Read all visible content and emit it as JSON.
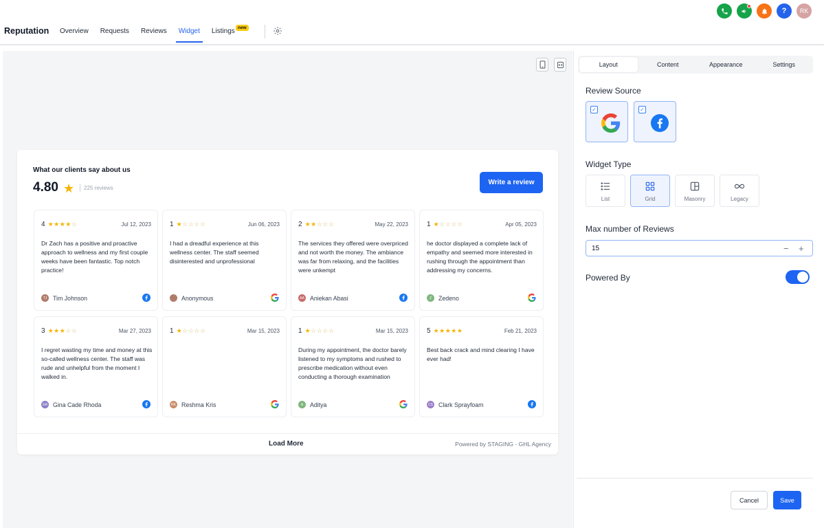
{
  "app": {
    "title": "Reputation",
    "nav_tabs": [
      {
        "label": "Overview"
      },
      {
        "label": "Requests"
      },
      {
        "label": "Reviews"
      },
      {
        "label": "Widget",
        "active": true
      },
      {
        "label": "Listings"
      }
    ],
    "new_badge": "new",
    "avatar_initials": "RK",
    "help_label": "?"
  },
  "widget": {
    "title": "What our clients say about us",
    "rating": "4.80",
    "review_count": "225 reviews",
    "write_button": "Write a review",
    "load_more": "Load More",
    "powered_by": "Powered by STAGING - GHL Agency",
    "reviews": [
      {
        "rating": "4",
        "stars": 4,
        "date": "Jul 12, 2023",
        "text": "Dr Zach has a positive and proactive approach to wellness and my first couple weeks have been fantastic. Top notch practice!",
        "author": "Tim Johnson",
        "initials": "TJ",
        "avatar_color": "#b07c6a",
        "source": "facebook"
      },
      {
        "rating": "1",
        "stars": 1,
        "date": "Jun 06, 2023",
        "text": "I had a dreadful experience at this wellness center. The staff seemed disinterested and unprofessional",
        "author": "Anonymous",
        "initials": "",
        "avatar_color": "#b07c6a",
        "source": "google"
      },
      {
        "rating": "2",
        "stars": 2,
        "date": "May 22, 2023",
        "text": "The services they offered were overpriced and not worth the money. The ambiance was far from relaxing, and the facilities were unkempt",
        "author": "Aniekan Abasi",
        "initials": "AA",
        "avatar_color": "#c76b6b",
        "source": "facebook"
      },
      {
        "rating": "1",
        "stars": 1,
        "date": "Apr 05, 2023",
        "text": "he doctor displayed a complete lack of empathy and seemed more interested in rushing through the appointment than addressing my concerns.",
        "author": "Zedeno",
        "initials": "Z",
        "avatar_color": "#7fb77e",
        "source": "google"
      },
      {
        "rating": "3",
        "stars": 3,
        "date": "Mar 27, 2023",
        "text": "I regret wasting my time and money at this so-called wellness center. The staff was rude and unhelpful from the moment I walked in.",
        "author": "Gina Cade Rhoda",
        "initials": "GR",
        "avatar_color": "#8a7fc7",
        "source": "facebook"
      },
      {
        "rating": "1",
        "stars": 1,
        "date": "Mar 15, 2023",
        "text": "",
        "author": "Reshma Kris",
        "initials": "RK",
        "avatar_color": "#c98e6b",
        "source": "google"
      },
      {
        "rating": "1",
        "stars": 1,
        "date": "Mar 15, 2023",
        "text": "During my appointment, the doctor barely listened to my symptoms and rushed to prescribe medication without even conducting a thorough examination",
        "author": "Aditya",
        "initials": "A",
        "avatar_color": "#7fb77e",
        "source": "google"
      },
      {
        "rating": "5",
        "stars": 5,
        "date": "Feb 21, 2023",
        "text": "Best back crack and mind clearing I have ever had!",
        "author": "Clark Sprayfoam",
        "initials": "CS",
        "avatar_color": "#9b7fc7",
        "source": "facebook"
      }
    ]
  },
  "panel": {
    "tabs": [
      {
        "label": "Layout",
        "active": true
      },
      {
        "label": "Content"
      },
      {
        "label": "Appearance"
      },
      {
        "label": "Settings"
      }
    ],
    "review_source_label": "Review Source",
    "widget_type_label": "Widget Type",
    "widget_types": [
      {
        "label": "List",
        "icon": "list-icon"
      },
      {
        "label": "Grid",
        "icon": "grid-icon",
        "active": true
      },
      {
        "label": "Masonry",
        "icon": "masonry-icon"
      },
      {
        "label": "Legacy",
        "icon": "infinity-icon"
      }
    ],
    "max_reviews_label": "Max number of Reviews",
    "max_reviews_value": "15",
    "stepper_minus": "−",
    "stepper_plus": "+",
    "powered_by_label": "Powered By",
    "powered_by_enabled": true,
    "cancel": "Cancel",
    "save": "Save"
  },
  "colors": {
    "primary": "#1d64f2",
    "star": "#f5b400",
    "facebook": "#1877f2"
  }
}
